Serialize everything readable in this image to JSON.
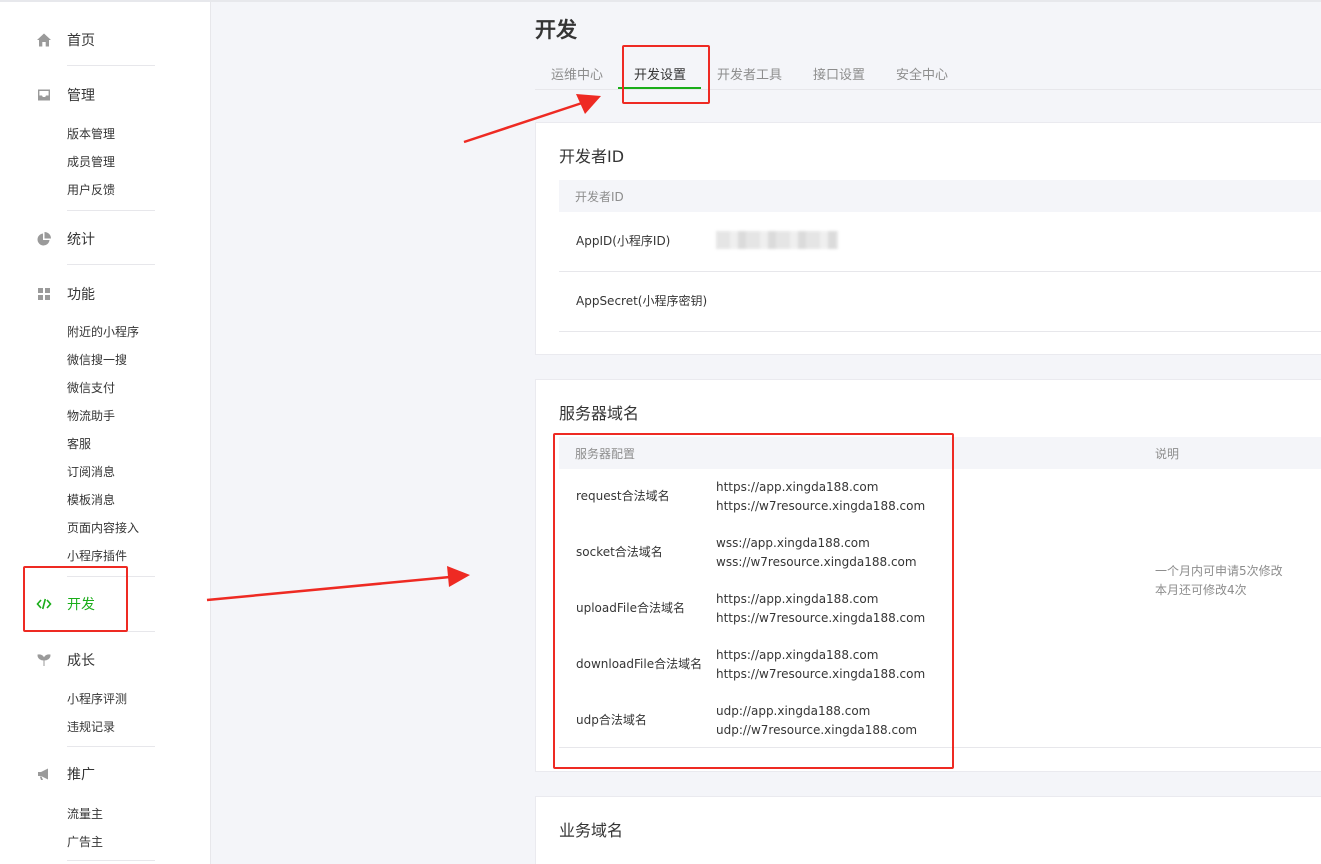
{
  "sidebar": {
    "home": "首页",
    "manage": {
      "label": "管理",
      "items": [
        "版本管理",
        "成员管理",
        "用户反馈"
      ]
    },
    "stats": "统计",
    "features": {
      "label": "功能",
      "items": [
        "附近的小程序",
        "微信搜一搜",
        "微信支付",
        "物流助手",
        "客服",
        "订阅消息",
        "模板消息",
        "页面内容接入",
        "小程序插件"
      ]
    },
    "dev": "开发",
    "growth": {
      "label": "成长",
      "items": [
        "小程序评测",
        "违规记录"
      ]
    },
    "promo": {
      "label": "推广",
      "items": [
        "流量主",
        "广告主"
      ]
    }
  },
  "page": {
    "title": "开发"
  },
  "tabs": [
    "运维中心",
    "开发设置",
    "开发者工具",
    "接口设置",
    "安全中心"
  ],
  "developer_id": {
    "title": "开发者ID",
    "header": "开发者ID",
    "rows": [
      "AppID(小程序ID)",
      "AppSecret(小程序密钥)"
    ]
  },
  "server_domain": {
    "title": "服务器域名",
    "headers": {
      "config": "服务器配置",
      "note": "说明"
    },
    "rows": [
      {
        "name": "request合法域名",
        "values": [
          "https://app.xingda188.com",
          "https://w7resource.xingda188.com"
        ]
      },
      {
        "name": "socket合法域名",
        "values": [
          "wss://app.xingda188.com",
          "wss://w7resource.xingda188.com"
        ]
      },
      {
        "name": "uploadFile合法域名",
        "values": [
          "https://app.xingda188.com",
          "https://w7resource.xingda188.com"
        ]
      },
      {
        "name": "downloadFile合法域名",
        "values": [
          "https://app.xingda188.com",
          "https://w7resource.xingda188.com"
        ]
      },
      {
        "name": "udp合法域名",
        "values": [
          "udp://app.xingda188.com",
          "udp://w7resource.xingda188.com"
        ]
      }
    ],
    "note": [
      "一个月内可申请5次修改",
      "本月还可修改4次"
    ]
  },
  "business_domain": {
    "title": "业务域名"
  },
  "colors": {
    "accent": "#1aad19",
    "annotation": "#ee2a23"
  },
  "icons": {
    "home": "home-icon",
    "manage": "inbox-icon",
    "stats": "pie-chart-icon",
    "features": "grid-icon",
    "dev": "code-icon",
    "growth": "sprout-icon",
    "promo": "megaphone-icon"
  }
}
